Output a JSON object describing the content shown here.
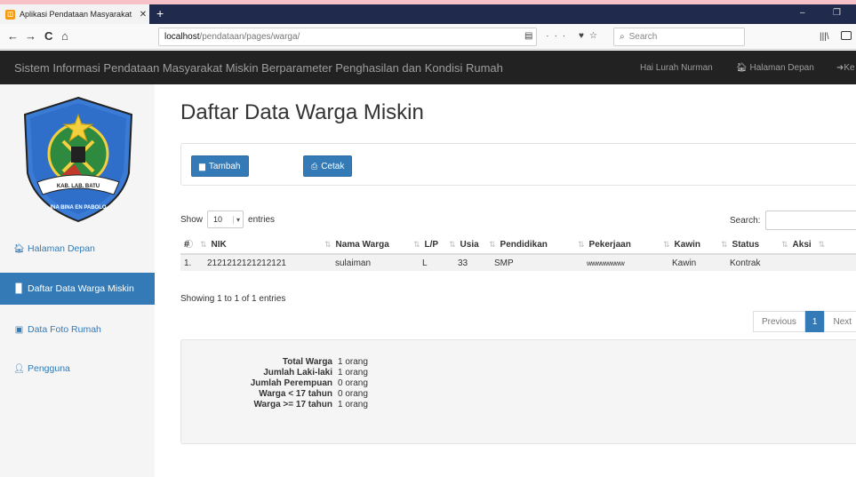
{
  "browser": {
    "tab_title": "Aplikasi Pendataan Masyarakat",
    "tab_close": "✕",
    "new_tab": "+",
    "url_host": "localhost",
    "url_path": "/pendataan/pages/warga/",
    "search_placeholder": "Search",
    "nav_back": "←",
    "nav_forward": "→",
    "nav_reload": "C",
    "nav_home": "⌂",
    "url_menu": "···",
    "window_min": "–",
    "window_max": "❐"
  },
  "header": {
    "title": "Sistem Informasi Pendataan Masyarakat Miskin Berparameter Penghasilan dan Kondisi Rumah",
    "greeting": "Hai Lurah Nurman",
    "home_link": "Halaman Depan",
    "logout_link": "Ke"
  },
  "logo": {
    "ribbon_text": "KAB. LAB. BATU",
    "motto": "INA BINA EN PABOLO"
  },
  "sidebar": {
    "items": [
      {
        "label": "Halaman Depan",
        "icon": "home-icon",
        "active": false
      },
      {
        "label": "Daftar Data Warga Miskin",
        "icon": "document-icon",
        "active": true
      },
      {
        "label": "Data Foto Rumah",
        "icon": "picture-icon",
        "active": false
      },
      {
        "label": "Pengguna",
        "icon": "user-icon",
        "active": false
      }
    ]
  },
  "main": {
    "page_title": "Daftar Data Warga Miskin",
    "add_button": "Tambah",
    "print_button": "Cetak",
    "show_label": "Show",
    "entries_label": "entries",
    "page_length": "10",
    "search_label": "Search:",
    "search_value": "",
    "columns": [
      "#",
      "NIK",
      "Nama Warga",
      "L/P",
      "Usia",
      "Pendidikan",
      "Pekerjaan",
      "Kawin",
      "Status",
      "Aksi"
    ],
    "rows": [
      {
        "no": "1.",
        "nik": "2121212121212121",
        "nama": "sulaiman",
        "lp": "L",
        "usia": "33",
        "pendidikan": "SMP",
        "pekerjaan": "wwwwwwww",
        "kawin": "Kawin",
        "status": "Kontrak"
      }
    ],
    "info": "Showing 1 to 1 of 1 entries",
    "pager": {
      "previous": "Previous",
      "current": "1",
      "next": "Next"
    }
  },
  "summary": [
    {
      "label": "Total Warga",
      "value": "1 orang"
    },
    {
      "label": "Jumlah Laki-laki",
      "value": "1 orang"
    },
    {
      "label": "Jumlah Perempuan",
      "value": "0 orang"
    },
    {
      "label": "Warga < 17 tahun",
      "value": "0 orang"
    },
    {
      "label": "Warga >= 17 tahun",
      "value": "1 orang"
    }
  ],
  "colors": {
    "primary": "#337ab7",
    "navbar": "#222222",
    "tabbar": "#1f2a4d"
  }
}
